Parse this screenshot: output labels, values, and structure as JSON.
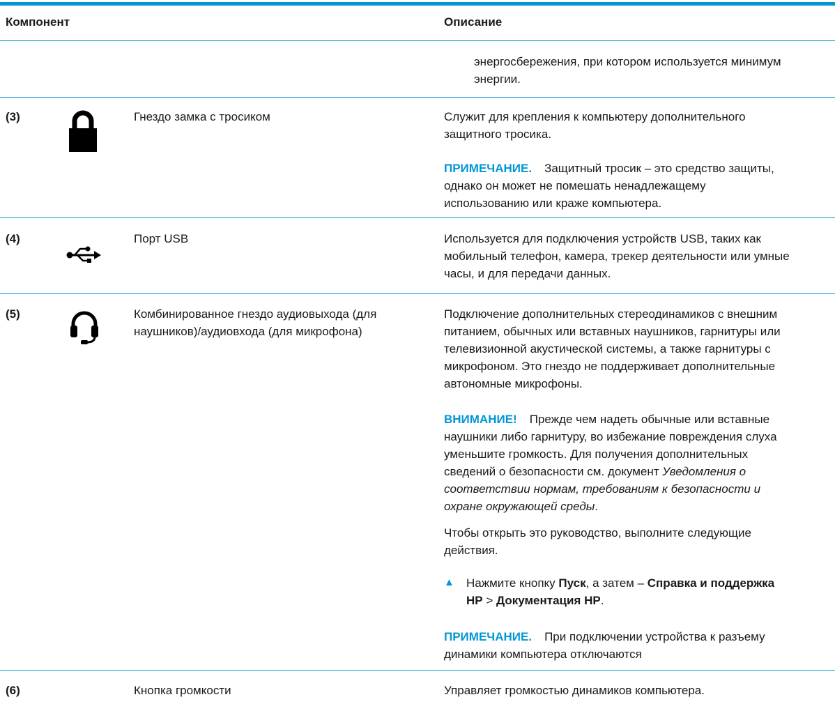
{
  "header": {
    "component": "Компонент",
    "description": "Описание"
  },
  "rows": {
    "r0": {
      "desc1": "энергосбережения, при котором используется минимум",
      "desc2": "энергии."
    },
    "r3": {
      "num": "(3)",
      "icon": "lock-icon",
      "name": "Гнездо замка с тросиком",
      "desc1": "Служит для крепления к компьютеру дополнительного",
      "desc2": "защитного тросика.",
      "note_label": "ПРИМЕЧАНИЕ.",
      "note1": "Защитный тросик – это средство защиты,",
      "note2": "однако он может не помешать ненадлежащему",
      "note3": "использованию или краже компьютера."
    },
    "r4": {
      "num": "(4)",
      "icon": "usb-icon",
      "name": "Порт USB",
      "desc1": "Используется для подключения устройств USB, таких как",
      "desc2": "мобильный телефон, камера, трекер деятельности или умные",
      "desc3": "часы, и для передачи данных."
    },
    "r5": {
      "num": "(5)",
      "icon": "headset-icon",
      "name1": "Комбинированное гнездо аудиовыхода (для",
      "name2": "наушников)/аудиовхода (для микрофона)",
      "desc1": "Подключение дополнительных стереодинамиков с внешним",
      "desc2": "питанием, обычных или вставных наушников, гарнитуры или",
      "desc3": "телевизионной акустической системы, а также гарнитуры с",
      "desc4": "микрофоном. Это гнездо не поддерживает дополнительные",
      "desc5": "автономные микрофоны.",
      "warn_label": "ВНИМАНИЕ!",
      "warn1": "Прежде чем надеть обычные или вставные",
      "warn2": "наушники либо гарнитуру, во избежание повреждения слуха",
      "warn3": "уменьшите громкость. Для получения дополнительных",
      "warn4a": "сведений о безопасности см. документ ",
      "warn4b": "Уведомления о",
      "warn5": "соответствии нормам, требованиям к безопасности и",
      "warn6": "охране окружающей среды",
      "warn6end": ".",
      "open1": "Чтобы открыть это руководство, выполните следующие",
      "open2": "действия.",
      "step_a": "Нажмите кнопку ",
      "step_b": "Пуск",
      "step_c": ", а затем – ",
      "step_d": "Справка и поддержка",
      "step_e": "HP",
      "step_f": " > ",
      "step_g": "Документация HP",
      "step_h": ".",
      "note_label": "ПРИМЕЧАНИЕ.",
      "note1": "При подключении устройства к разъему",
      "note2": "динамики компьютера отключаются"
    },
    "r6": {
      "num": "(6)",
      "name": "Кнопка громкости",
      "desc": "Управляет громкостью динамиков компьютера."
    }
  }
}
